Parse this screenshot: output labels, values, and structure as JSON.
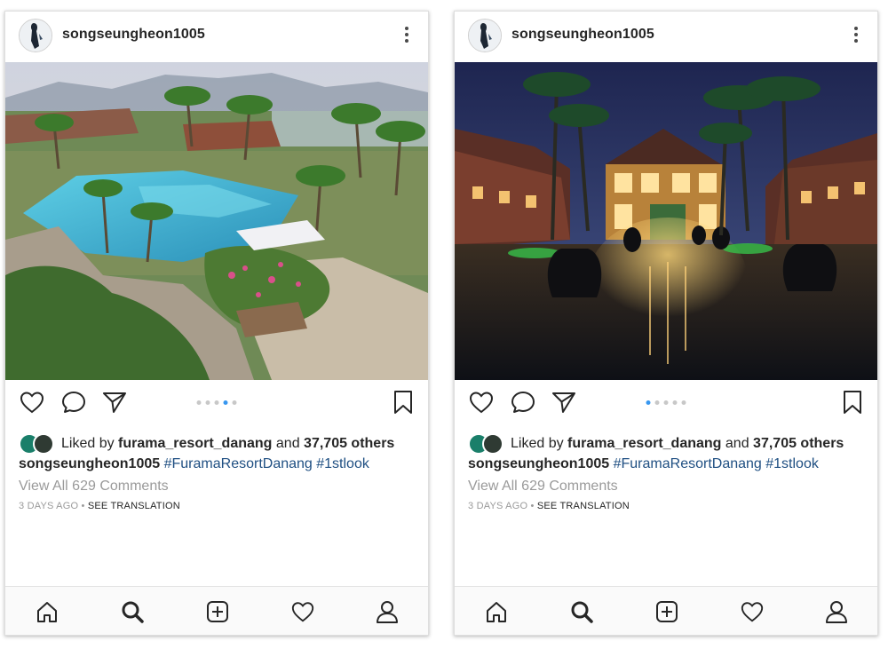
{
  "posts": [
    {
      "username": "songseungheon1005",
      "liked_by_prefix": "Liked by",
      "liked_by_user": "furama_resort_danang",
      "liked_by_and": "and",
      "likes_others": "37,705 others",
      "caption_user": "songseungheon1005",
      "caption_tags": "#FuramaResortDanang #1stlook",
      "view_comments": "View All 629 Comments",
      "time_ago": "3 DAYS AGO",
      "separator": "•",
      "see_translation": "SEE TRANSLATION",
      "carousel_active_index": 3,
      "carousel_count": 5
    },
    {
      "username": "songseungheon1005",
      "liked_by_prefix": "Liked by",
      "liked_by_user": "furama_resort_danang",
      "liked_by_and": "and",
      "likes_others": "37,705 others",
      "caption_user": "songseungheon1005",
      "caption_tags": "#FuramaResortDanang #1stlook",
      "view_comments": "View All 629 Comments",
      "time_ago": "3 DAYS AGO",
      "separator": "•",
      "see_translation": "SEE TRANSLATION",
      "carousel_active_index": 0,
      "carousel_count": 5
    }
  ],
  "icons": {
    "like": "heart-icon",
    "comment": "comment-icon",
    "share": "send-icon",
    "save": "bookmark-icon",
    "more": "more-options-icon",
    "nav": [
      "home-icon",
      "search-icon",
      "add-post-icon",
      "activity-heart-icon",
      "profile-icon"
    ]
  },
  "colors": {
    "carousel_active": "#3897f0",
    "hashtag": "#1f4f82",
    "muted_text": "#9a9a9a"
  }
}
